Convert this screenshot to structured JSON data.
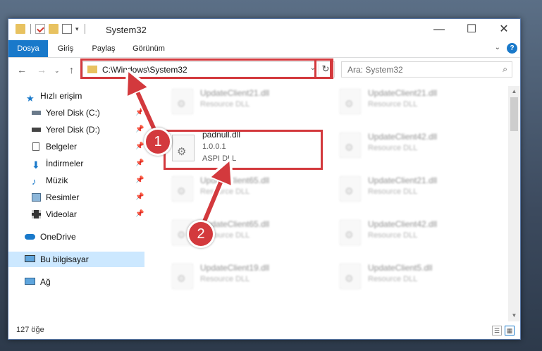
{
  "window": {
    "title": "System32"
  },
  "ribbon": {
    "tabs": [
      "Dosya",
      "Giriş",
      "Paylaş",
      "Görünüm"
    ],
    "help": "?"
  },
  "address": {
    "path": "C:\\Windows\\System32"
  },
  "search": {
    "placeholder": "Ara: System32"
  },
  "nav": {
    "items": [
      {
        "label": "Hızlı erişim",
        "icon": "star-icon",
        "pinned": false
      },
      {
        "label": "Yerel Disk (C:)",
        "icon": "drive-icon",
        "pinned": true
      },
      {
        "label": "Yerel Disk (D:)",
        "icon": "drive-icon",
        "pinned": true
      },
      {
        "label": "Belgeler",
        "icon": "documents-icon",
        "pinned": true
      },
      {
        "label": "İndirmeler",
        "icon": "download-icon",
        "pinned": true
      },
      {
        "label": "Müzik",
        "icon": "music-icon",
        "pinned": true
      },
      {
        "label": "Resimler",
        "icon": "pictures-icon",
        "pinned": true
      },
      {
        "label": "Videolar",
        "icon": "videos-icon",
        "pinned": true
      },
      {
        "label": "OneDrive",
        "icon": "cloud-icon",
        "pinned": false
      },
      {
        "label": "Bu bilgisayar",
        "icon": "computer-icon",
        "pinned": false,
        "selected": true
      },
      {
        "label": "Ağ",
        "icon": "network-icon",
        "pinned": false
      }
    ]
  },
  "files": {
    "left": [
      {
        "name": "UpdateClient21.dll",
        "desc": "Resource DLL"
      },
      {
        "name": "UpdateClient65.dll",
        "desc": "Resource DLL"
      },
      {
        "name": "UpdateClient65.dll",
        "desc": "Resource DLL"
      },
      {
        "name": "UpdateClient19.dll",
        "desc": "Resource DLL"
      }
    ],
    "right": [
      {
        "name": "UpdateClient21.dll",
        "desc": "Resource DLL"
      },
      {
        "name": "UpdateClient42.dll",
        "desc": "Resource DLL"
      },
      {
        "name": "UpdateClient21.dll",
        "desc": "Resource DLL"
      },
      {
        "name": "UpdateClient42.dll",
        "desc": "Resource DLL"
      },
      {
        "name": "UpdateClient5.dll",
        "desc": "Resource DLL"
      }
    ],
    "target": {
      "name": "padnull.dll",
      "version": "1.0.0.1",
      "desc": "ASPI DLL"
    }
  },
  "status": {
    "count": "127 öğe"
  },
  "steps": {
    "one": "1",
    "two": "2"
  },
  "colors": {
    "accent": "#1979ca",
    "highlight": "#d3393d",
    "selected": "#cce8ff"
  }
}
